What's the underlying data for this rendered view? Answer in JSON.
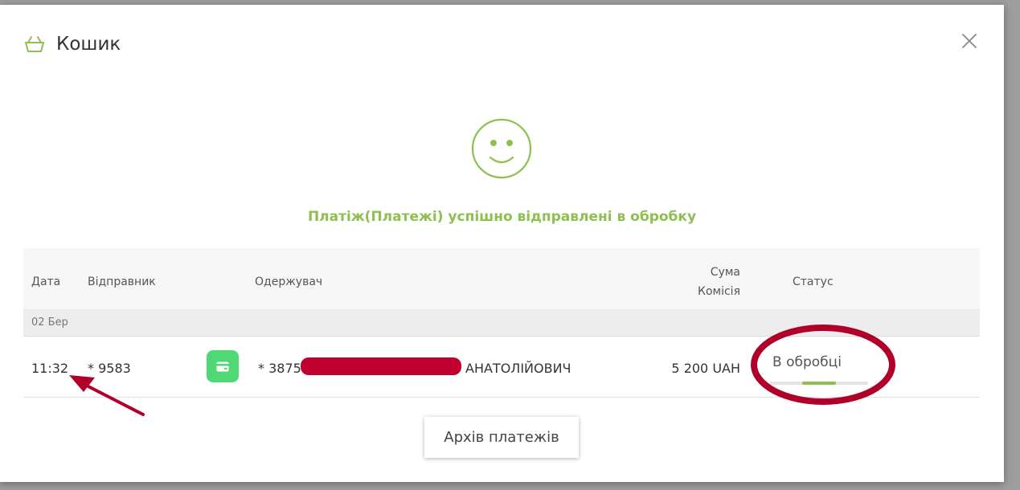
{
  "header": {
    "title": "Кошик",
    "icon": "basket-icon",
    "close_icon": "close-icon"
  },
  "success": {
    "icon": "smiley-icon",
    "message": "Платіж(Платежі) успішно відправлені в обробку"
  },
  "table": {
    "columns": {
      "date": "Дата",
      "sender": "Відправник",
      "recipient": "Одержувач",
      "sum": "Сума",
      "commission": "Комісія",
      "status": "Статус"
    },
    "groups": [
      {
        "date": "02 Бер",
        "rows": [
          {
            "time": "11:32",
            "sender": "* 9583",
            "icon": "card-icon",
            "recipient_prefix": "* 3875",
            "recipient_suffix": "АНАТОЛІЙОВИЧ",
            "amount": "5 200 UAH",
            "status": "В обробці",
            "progress": 0.5
          }
        ]
      }
    ]
  },
  "archive_button": {
    "label": "Архів платежів"
  },
  "colors": {
    "accent": "#8dc04e",
    "card_icon_bg": "#4fd873",
    "annotation": "#b0002a",
    "redaction": "#c0002f"
  }
}
